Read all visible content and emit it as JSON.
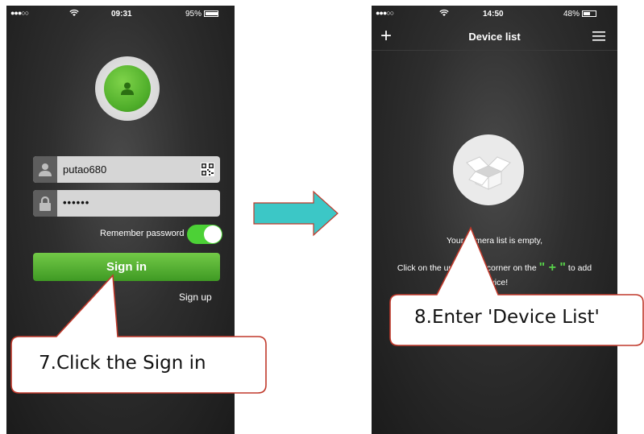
{
  "left_screen": {
    "status": {
      "signal": "●●●○○",
      "wifi": "wifi-icon",
      "time": "09:31",
      "battery": "95%"
    },
    "avatar_icon": "user-icon",
    "username": "putao680",
    "password_mask": "••••••",
    "remember_label": "Remember password",
    "remember_on": true,
    "signin_label": "Sign in",
    "signup_label": "Sign up"
  },
  "right_screen": {
    "status": {
      "signal": "●●●○○",
      "wifi": "wifi-icon",
      "time": "14:50",
      "battery": "48%"
    },
    "nav_title": "Device list",
    "add_symbol": "+",
    "empty_message": "Your camera list is empty,",
    "hint_prefix": "Click on the upper right corner on the ",
    "hint_plus": "\" + \"",
    "hint_suffix": " to add",
    "hint_line2": "device!"
  },
  "callouts": {
    "left": "7.Click the Sign in",
    "right": "8.Enter 'Device List'"
  },
  "colors": {
    "accent_green": "#4cd136",
    "button_green": "#5ab636",
    "arrow_fill": "#3cc7c6",
    "arrow_stroke": "#c0392b",
    "callout_stroke": "#c0392b"
  }
}
